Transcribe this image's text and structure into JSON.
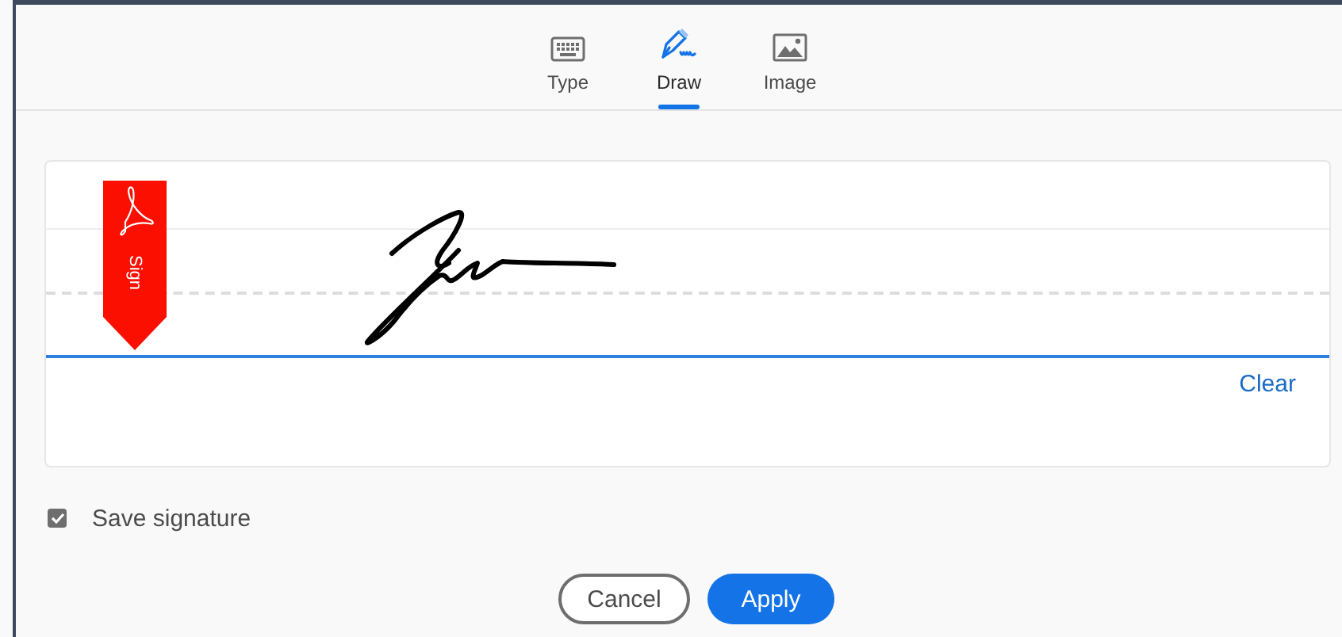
{
  "tabs": [
    {
      "kind": "keyboard",
      "label": "Type",
      "selected": false
    },
    {
      "kind": "pen",
      "label": "Draw",
      "selected": true
    },
    {
      "kind": "image",
      "label": "Image",
      "selected": false
    }
  ],
  "signature_pad": {
    "badge": "Sign",
    "clear": "Clear"
  },
  "save_signature": {
    "label": "Save signature",
    "checked": true
  },
  "buttons": [
    {
      "kind": "secondary",
      "label": "Cancel"
    },
    {
      "kind": "primary",
      "label": "Apply"
    }
  ]
}
